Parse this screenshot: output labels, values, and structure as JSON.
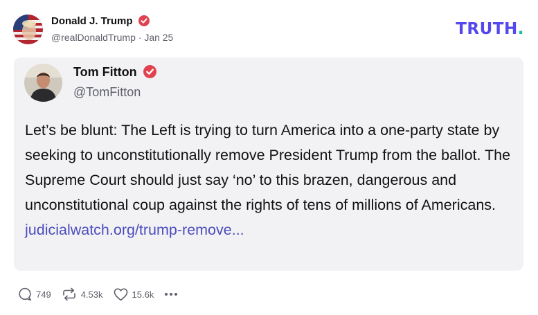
{
  "post": {
    "author": {
      "name": "Donald J. Trump",
      "handle": "@realDonaldTrump",
      "date": "Jan 25",
      "verified_icon": "verified-badge-icon"
    },
    "brand": {
      "logo_text": "TRUTH",
      "logo_dot": ".",
      "colors": {
        "purple": "#5448ee",
        "teal": "#13c2a3"
      }
    },
    "quote": {
      "author": {
        "name": "Tom Fitton",
        "handle": "@TomFitton",
        "verified_icon": "verified-badge-icon"
      },
      "text": "Let’s be blunt: The Left is trying to turn America into a one-party state by seeking to unconstitutionally remove President Trump from the ballot. The Supreme Court should just say ‘no’ to this brazen, dangerous and unconstitutional coup against the rights of tens of millions of Americans.",
      "link_text": "judicialwatch.org/trump-remove..."
    },
    "actions": {
      "replies": {
        "icon": "reply-icon",
        "count": "749"
      },
      "retruths": {
        "icon": "retruth-icon",
        "count": "4.53k"
      },
      "likes": {
        "icon": "heart-icon",
        "count": "15.6k"
      },
      "more": {
        "icon": "more-icon",
        "label": "•••"
      }
    }
  },
  "colors": {
    "verified": "#e0434f",
    "link": "#4c4cbe",
    "card_background": "#f2f2f5",
    "muted_text": "#5f5f6b"
  }
}
